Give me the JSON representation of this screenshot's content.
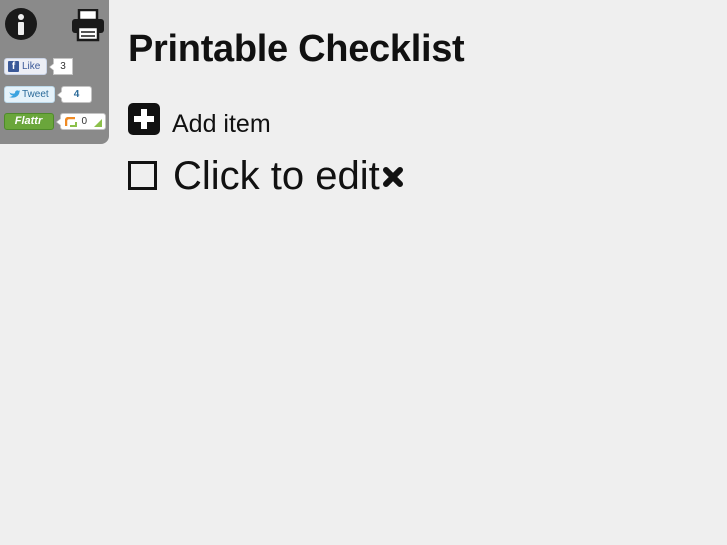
{
  "header": {
    "title": "Printable Checklist"
  },
  "toolbar": {
    "info_icon": "info-icon",
    "print_icon": "printer-icon"
  },
  "social": {
    "facebook": {
      "label": "Like",
      "count": "3",
      "color": "#3b5998"
    },
    "twitter": {
      "label": "Tweet",
      "count": "4",
      "color": "#2a6a99"
    },
    "flattr": {
      "label": "Flattr",
      "count": "0",
      "color": "#6aa63b"
    }
  },
  "checklist": {
    "add_label": "Add item",
    "add_icon": "plus-icon",
    "items": [
      {
        "text": "Click to edit",
        "checked": false,
        "delete_icon": "close-icon"
      }
    ]
  }
}
